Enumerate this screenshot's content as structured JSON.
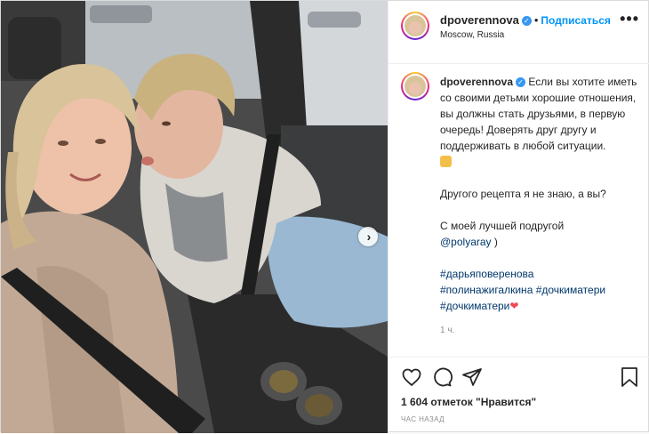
{
  "post": {
    "username": "dpoverennova",
    "verified": true,
    "follow_label": "Подписаться",
    "location": "Moscow, Russia",
    "more_label": "•••",
    "next_label": "›"
  },
  "caption": {
    "paragraph1": "Если вы хотите иметь со своими детьми хорошие отношения, вы должны стать друзьями, в первую очередь! Доверять друг другу и поддерживать в любой ситуации.",
    "paragraph2": "Другого рецепта я не знаю, а вы?",
    "paragraph3_prefix": "С моей лучшей подругой",
    "mention": "@polyaray",
    "paragraph3_suffix": ")",
    "hashtags": [
      "#дарьяповеренова",
      "#полинажигалкина",
      "#дочкиматери",
      "#дочкиматери"
    ],
    "time": "1 ч."
  },
  "actions": {
    "likes_text": "1 604 отметок \"Нравится\"",
    "posted_ago": "ЧАС НАЗАД"
  },
  "icons": {
    "like": "heart-outline-icon",
    "comment": "comment-bubble-icon",
    "share": "paper-plane-icon",
    "save": "bookmark-icon",
    "verified": "verified-badge-icon"
  },
  "colors": {
    "accent": "#0095f6",
    "verified": "#3897f0",
    "heart": "#ed4956",
    "mention": "#00376b"
  }
}
